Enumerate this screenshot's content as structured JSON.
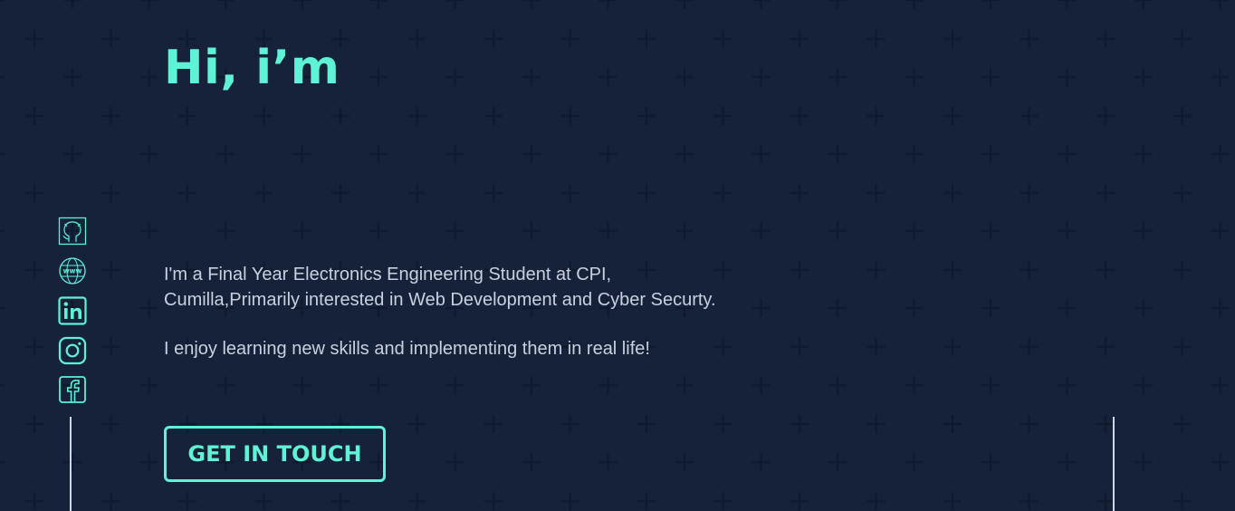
{
  "hero": {
    "title": "Hi, i’m"
  },
  "social": {
    "icons": [
      "github-icon",
      "website-icon",
      "linkedin-icon",
      "instagram-icon",
      "facebook-icon"
    ]
  },
  "bio": {
    "paragraph_1": "I'm a Final Year Electronics Engineering Student at CPI, Cumilla,Primarily interested in Web Development and Cyber Securty.",
    "paragraph_2": "I enjoy learning new skills and implementing them in real life!"
  },
  "cta": {
    "label": "GET IN TOUCH"
  },
  "colors": {
    "background": "#16223a",
    "accent": "#5ef2d6",
    "text": "#c9d1e0",
    "pattern": "#0f1a2e"
  }
}
